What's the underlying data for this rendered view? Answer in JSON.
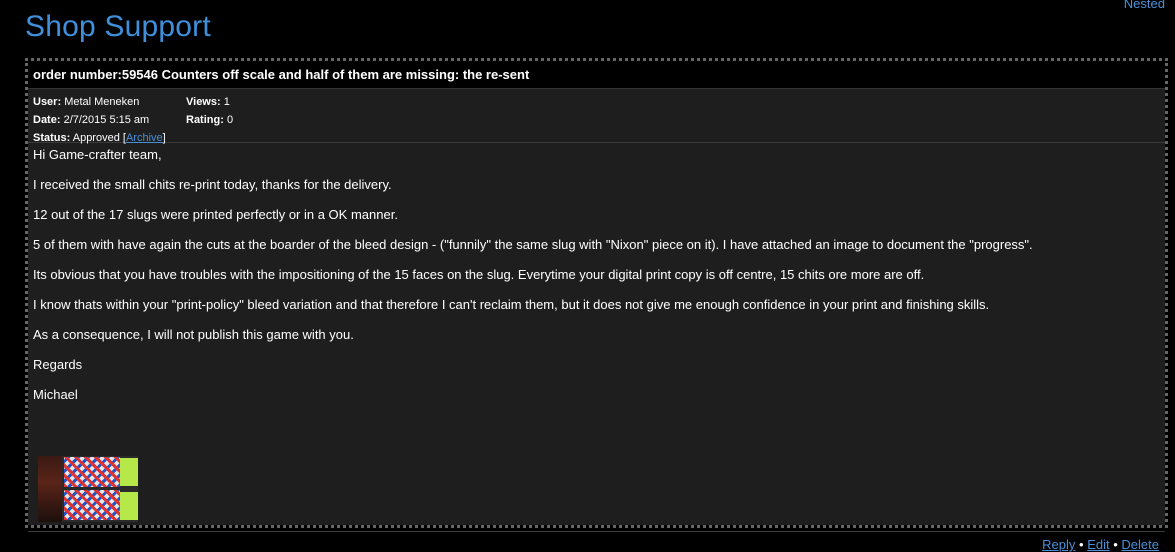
{
  "header": {
    "nested_link": "Nested",
    "title": "Shop Support"
  },
  "post": {
    "subject": "order number:59546 Counters off scale and half of them are missing: the re-sent",
    "meta": {
      "user_label": "User:",
      "user_value": "Metal Meneken",
      "views_label": "Views:",
      "views_value": "1",
      "date_label": "Date:",
      "date_value": "2/7/2015 5:15 am",
      "rating_label": "Rating:",
      "rating_value": "0",
      "status_label": "Status:",
      "status_value": "Approved",
      "archive_link": "Archive"
    },
    "body": [
      "Hi Game-crafter team,",
      "I received the small chits re-print today, thanks for the delivery.",
      "12 out of the 17 slugs were printed perfectly or in a OK manner.",
      "5 of them with have again the cuts at the boarder of the bleed design - (\"funnily\" the same slug with \"Nixon\" piece on it). I have attached an image to document the \"progress\".",
      "Its obvious that you have troubles with the impositioning of the 15 faces on the slug. Everytime your digital print copy is off centre, 15 chits ore more are off.",
      "I know thats within your \"print-policy\" bleed variation and that therefore I can't reclaim them, but it does not give me enough confidence in your print and finishing skills.",
      "As a consequence, I will not publish this game with you.",
      "Regards",
      "Michael"
    ],
    "actions": {
      "reply": "Reply",
      "edit": "Edit",
      "delete": "Delete",
      "separator": "•"
    }
  },
  "colors": {
    "title_blue": "#3f8fdb",
    "link_blue": "#4a90d9",
    "post_background": "#1e1e1e",
    "page_background": "#000000"
  }
}
